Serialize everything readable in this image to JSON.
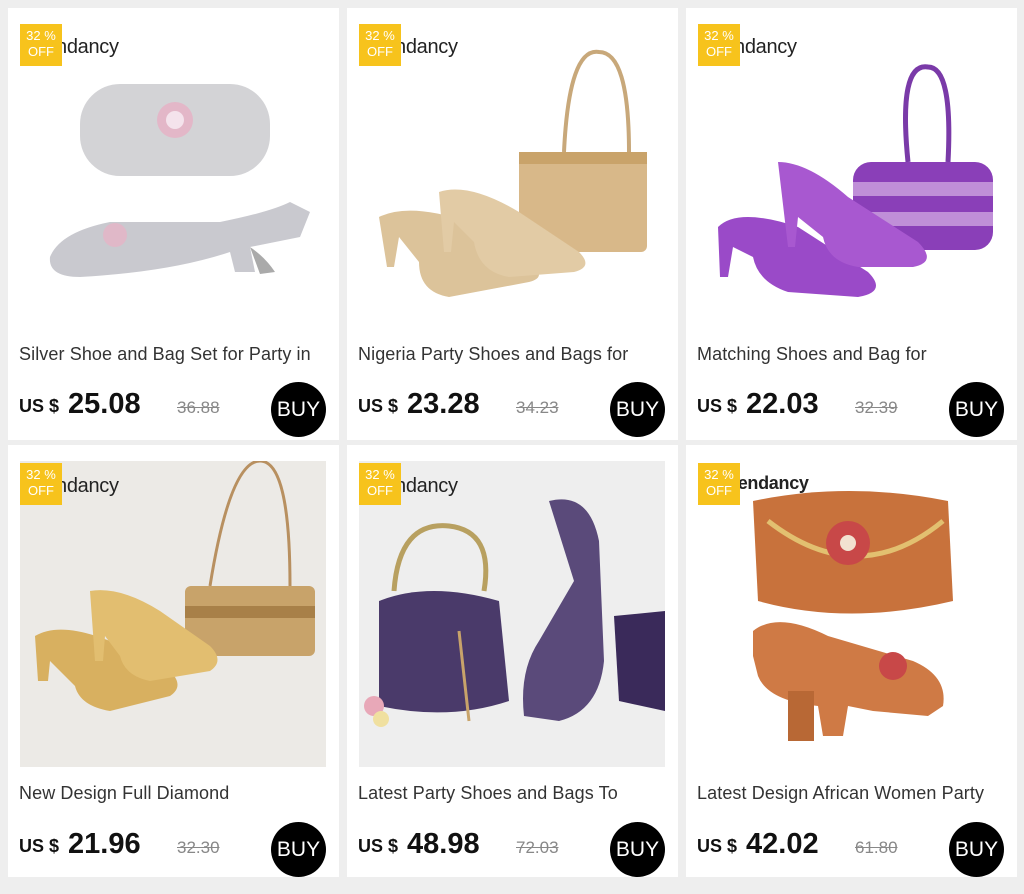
{
  "products": [
    {
      "brand": "ndancy",
      "badge_pct": "32 %",
      "badge_off": "OFF",
      "title": "Silver Shoe and Bag Set for Party in",
      "currency": "US $",
      "price": "25.08",
      "original": "36.88",
      "buy": "BUY",
      "theme": "#c9c9cf"
    },
    {
      "brand": "ndancy",
      "badge_pct": "32 %",
      "badge_off": "OFF",
      "title": "Nigeria Party Shoes and Bags for",
      "currency": "US $",
      "price": "23.28",
      "original": "34.23",
      "buy": "BUY",
      "theme": "#d8b889"
    },
    {
      "brand": "ndancy",
      "badge_pct": "32 %",
      "badge_off": "OFF",
      "title": "Matching Shoes and Bag for",
      "currency": "US $",
      "price": "22.03",
      "original": "32.39",
      "buy": "BUY",
      "theme": "#8a3fb8"
    },
    {
      "brand": "ndancy",
      "badge_pct": "32 %",
      "badge_off": "OFF",
      "title": "New Design Full Diamond",
      "currency": "US $",
      "price": "21.96",
      "original": "32.30",
      "buy": "BUY",
      "theme": "#d8b060"
    },
    {
      "brand": "ndancy",
      "badge_pct": "32 %",
      "badge_off": "OFF",
      "title": "Latest Party Shoes and Bags To",
      "currency": "US $",
      "price": "48.98",
      "original": "72.03",
      "buy": "BUY",
      "theme": "#4a3a6a"
    },
    {
      "brand": "cendancy",
      "badge_pct": "32 %",
      "badge_off": "OFF",
      "title": "Latest Design African Women Party",
      "currency": "US $",
      "price": "42.02",
      "original": "61.80",
      "buy": "BUY",
      "theme": "#cf7a45"
    }
  ]
}
